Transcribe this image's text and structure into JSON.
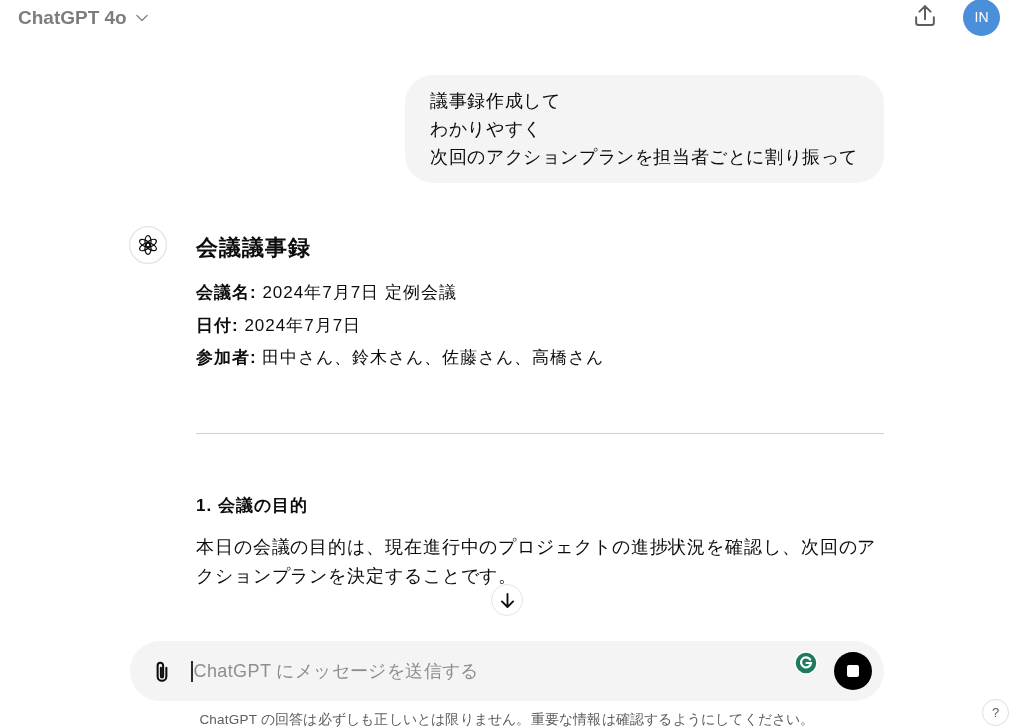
{
  "header": {
    "model": "ChatGPT 4o",
    "avatar": "IN"
  },
  "messages": [
    {
      "kind": "user",
      "lines": [
        "議事録作成して",
        "わかりやすく",
        "次回のアクションプランを担当者ごとに割り振って"
      ]
    },
    {
      "kind": "assistant",
      "blocks": [
        {
          "kind": "heading",
          "text": "会議議事録"
        },
        {
          "kind": "field",
          "text": "**会議名:** 2024年7月7日 定例会議"
        },
        {
          "kind": "field",
          "text": "**日付:** 2024年7月7日"
        },
        {
          "kind": "field",
          "text": "**参加者:** 田中さん、鈴木さん、佐藤さん、高橋さん"
        },
        {
          "kind": "rule"
        },
        {
          "kind": "subheading",
          "text": "1. 会議の目的"
        },
        {
          "kind": "paragraph",
          "text": "本日の会議の目的は、現在進行中のプロジェクトの進捗状況を確認し、次回のアクションプランを決定することです。"
        }
      ]
    }
  ],
  "composer": {
    "placeholder": "ChatGPT にメッセージを送信する"
  },
  "disclaimer": "ChatGPT の回答は必ずしも正しいとは限りません。重要な情報は確認するようにしてください。",
  "help": "?"
}
